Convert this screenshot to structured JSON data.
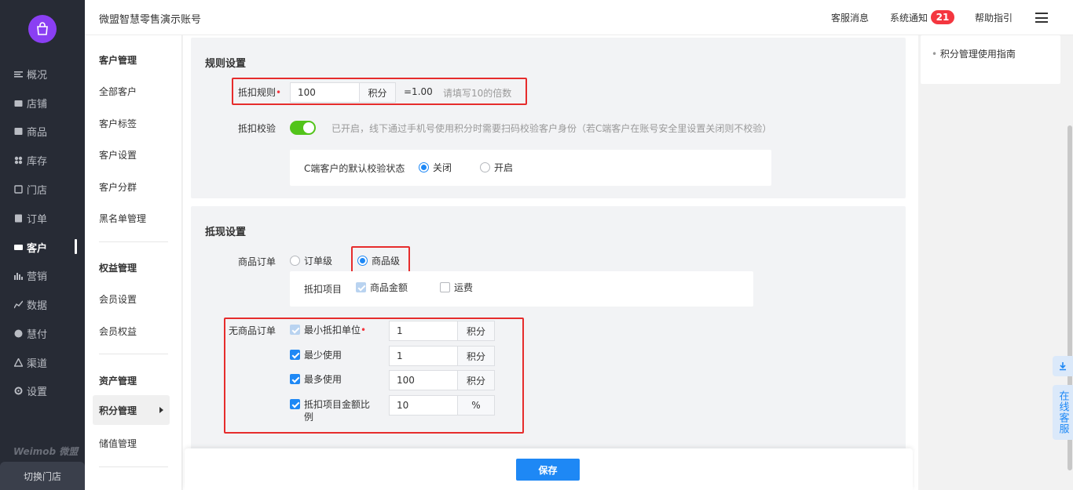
{
  "app": {
    "account_name": "微盟智慧零售演示账号",
    "brand": "Weimob 微盟",
    "switch_store": "切换门店",
    "brand_color": "#8a3ff3",
    "accent_color": "#1e88f5"
  },
  "topbar": {
    "service_msg": "客服消息",
    "system_notice": "系统通知",
    "notice_count": "21",
    "help": "帮助指引"
  },
  "nav": {
    "items": [
      {
        "label": "概况",
        "icon": "overview-icon"
      },
      {
        "label": "店铺",
        "icon": "store-icon"
      },
      {
        "label": "商品",
        "icon": "goods-icon"
      },
      {
        "label": "库存",
        "icon": "inventory-icon"
      },
      {
        "label": "门店",
        "icon": "shop-icon"
      },
      {
        "label": "订单",
        "icon": "order-icon"
      },
      {
        "label": "客户",
        "icon": "customer-icon",
        "active": true
      },
      {
        "label": "营销",
        "icon": "marketing-icon"
      },
      {
        "label": "数据",
        "icon": "data-icon"
      },
      {
        "label": "慧付",
        "icon": "pay-icon"
      },
      {
        "label": "渠道",
        "icon": "channel-icon"
      },
      {
        "label": "设置",
        "icon": "settings-icon"
      }
    ]
  },
  "subnav": {
    "group1": "客户管理",
    "g1_items": [
      "全部客户",
      "客户标签",
      "客户设置",
      "客户分群",
      "黑名单管理"
    ],
    "group2": "权益管理",
    "g2_items": [
      "会员设置",
      "会员权益"
    ],
    "group3": "资产管理",
    "g3_items": [
      "积分管理",
      "储值管理"
    ]
  },
  "rules": {
    "title": "规则设置",
    "deduct_rule_label": "抵扣规则",
    "deduct_value": "100",
    "deduct_unit": "积分",
    "equals": "=1.00",
    "deduct_hint": "请填写10的倍数",
    "verify_label": "抵扣校验",
    "verify_on": true,
    "verify_hint": "已开启，线下通过手机号使用积分时需要扫码校验客户身份（若C端客户在账号安全里设置关闭则不校验）",
    "c_default_label": "C端客户的默认校验状态",
    "c_options": [
      "关闭",
      "开启"
    ],
    "c_selected": "关闭"
  },
  "cash": {
    "title": "抵现设置",
    "goods_order_label": "商品订单",
    "order_level": "订单级",
    "goods_level": "商品级",
    "selected": "商品级",
    "deduct_items_label": "抵扣项目",
    "item_goods_amount": "商品金额",
    "item_freight": "运费",
    "no_goods_label": "无商品订单",
    "min_unit_label": "最小抵扣单位",
    "min_unit_value": "1",
    "min_use_label": "最少使用",
    "min_use_value": "1",
    "max_use_label": "最多使用",
    "max_use_value": "100",
    "ratio_label": "抵扣项目金额比例",
    "ratio_value": "10",
    "unit_points": "积分",
    "unit_percent": "%"
  },
  "save": "保存",
  "right": {
    "guide": "积分管理使用指南",
    "online_service": "在线客服"
  }
}
